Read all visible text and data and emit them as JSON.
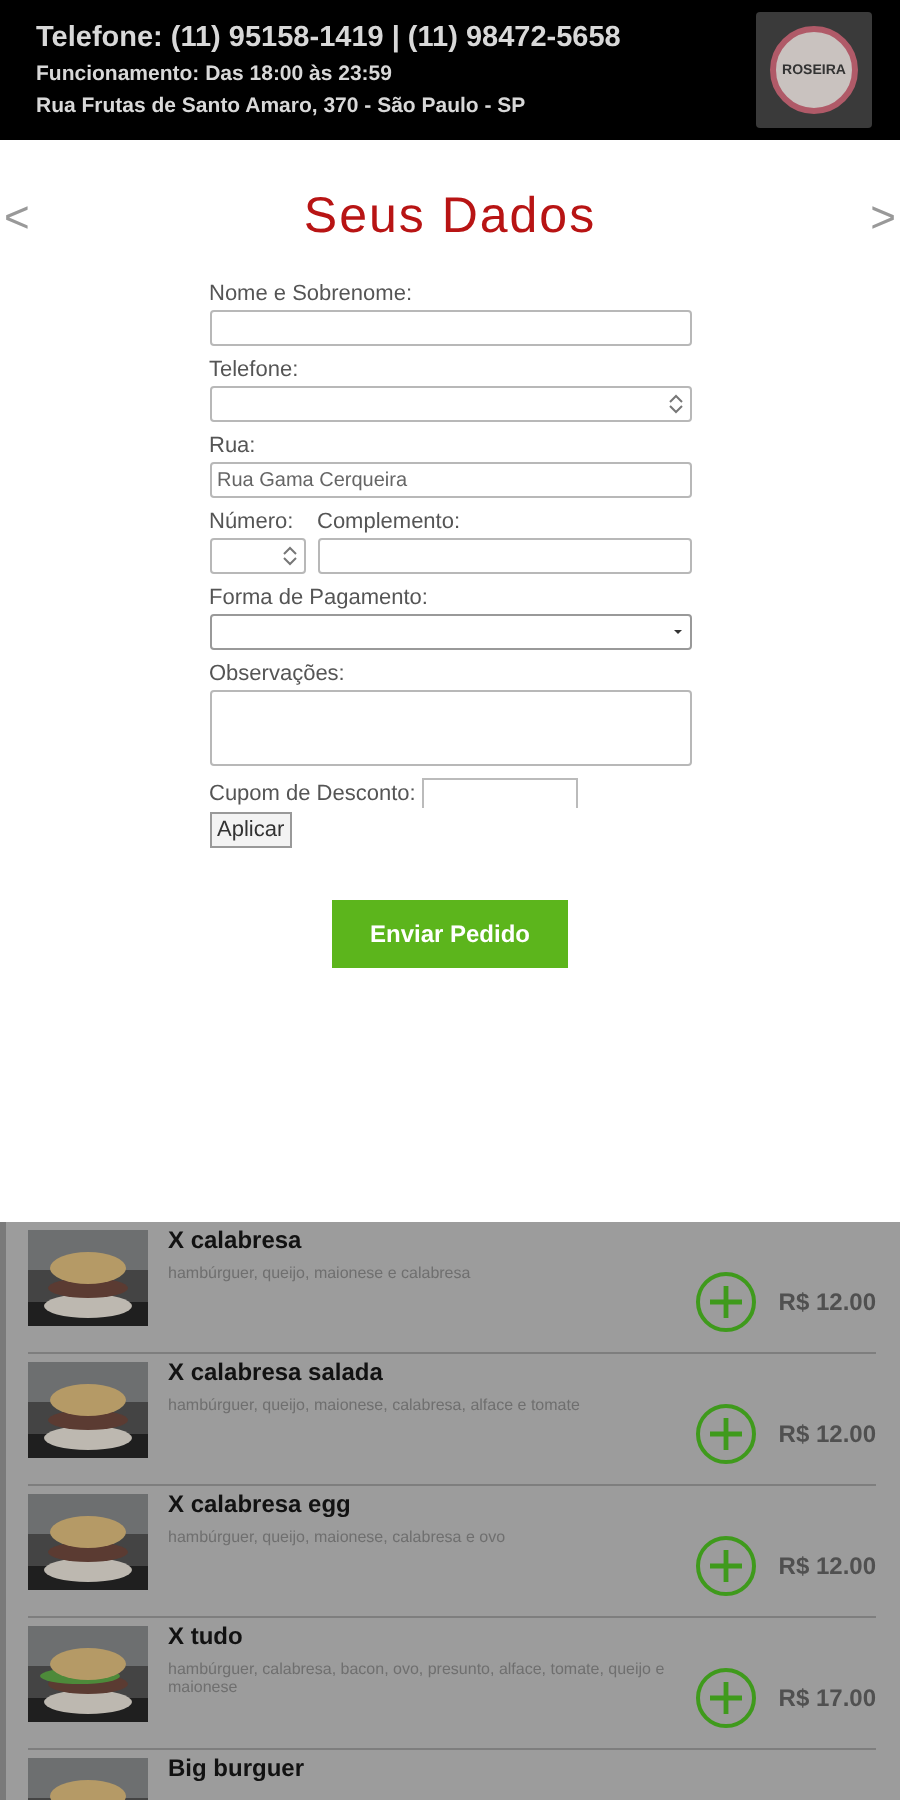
{
  "header": {
    "phone": "Telefone: (11) 95158-1419 | (11) 98472-5658",
    "hours": "Funcionamento: Das 18:00 às 23:59",
    "address": "Rua Frutas de Santo Amaro, 370 - São Paulo - SP",
    "logo": "ROSEIRA"
  },
  "modal": {
    "prev": "<",
    "next": ">",
    "title": "Seus Dados",
    "name": {
      "label": "Nome e Sobrenome:"
    },
    "phone": {
      "label": "Telefone:"
    },
    "street": {
      "label": "Rua:",
      "value": "Rua Gama Cerqueira"
    },
    "number": {
      "label": "Número:"
    },
    "complement": {
      "label": "Complemento:"
    },
    "payment": {
      "label": "Forma de Pagamento:"
    },
    "notes": {
      "label": "Observações:"
    },
    "coupon": {
      "label": "Cupom de Desconto:"
    },
    "apply": "Aplicar",
    "submit": "Enviar Pedido"
  },
  "menu": [
    {
      "name": "X calabresa",
      "description": "hambúrguer, queijo, maionese e calabresa",
      "price": "R$ 12.00"
    },
    {
      "name": "X calabresa salada",
      "description": "hambúrguer, queijo, maionese, calabresa, alface e tomate",
      "price": "R$ 12.00"
    },
    {
      "name": "X calabresa egg",
      "description": "hambúrguer, queijo, maionese, calabresa e ovo",
      "price": "R$ 12.00"
    },
    {
      "name": "X tudo",
      "description": "hambúrguer, calabresa, bacon, ovo, presunto, alface, tomate, queijo e maionese",
      "price": "R$ 17.00"
    },
    {
      "name": "Big burguer"
    }
  ]
}
